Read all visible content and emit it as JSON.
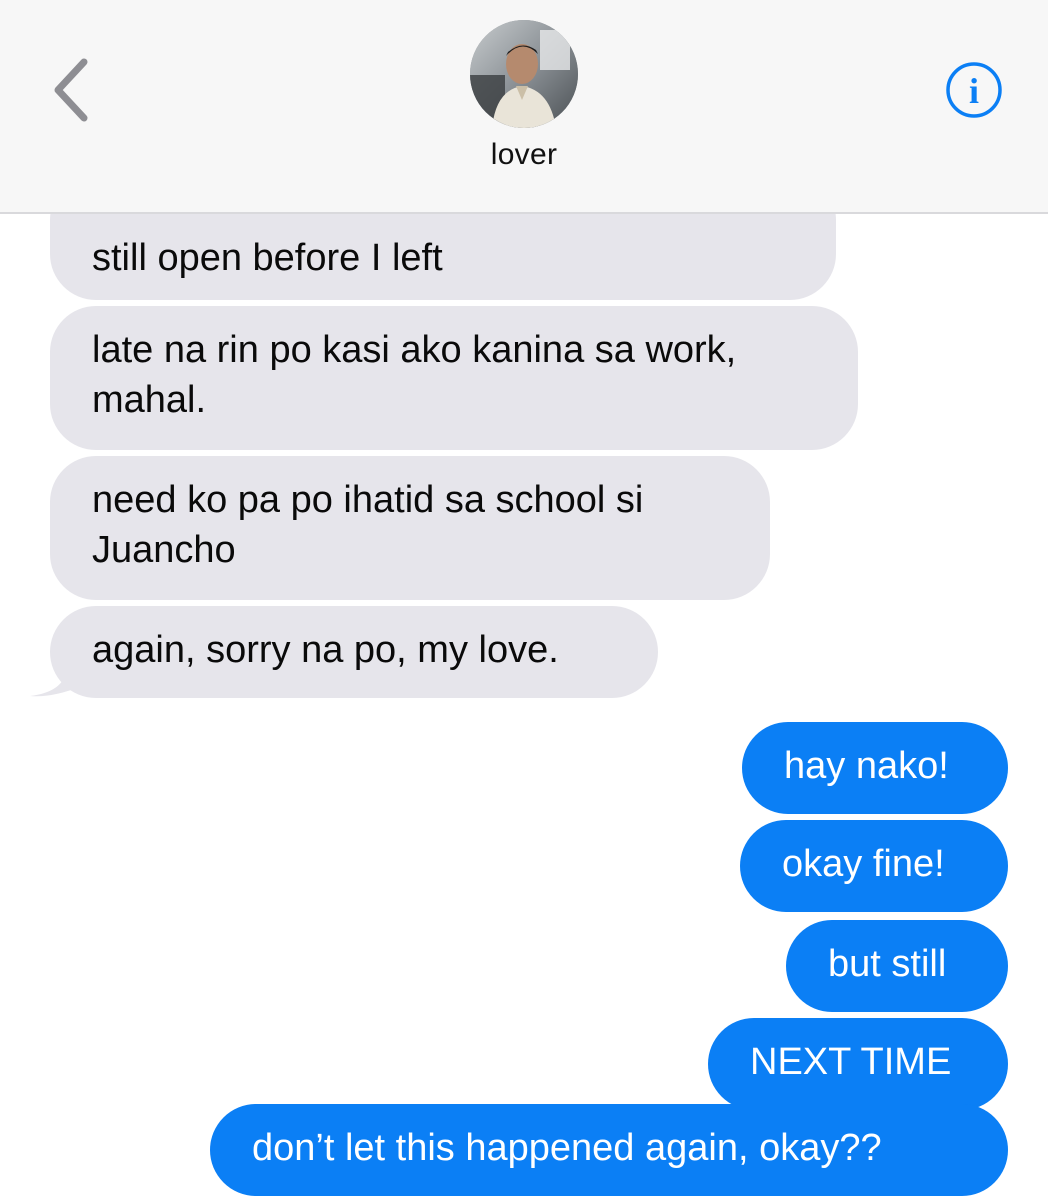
{
  "header": {
    "contact_name": "lover",
    "back_icon": "chevron-left-icon",
    "info_icon": "info-circle-icon",
    "accent_color": "#0b7ff5"
  },
  "messages": [
    {
      "direction": "incoming",
      "text": "still open before I left"
    },
    {
      "direction": "incoming",
      "text_lines": [
        "late na rin po kasi ako kanina sa work,",
        "mahal."
      ]
    },
    {
      "direction": "incoming",
      "text_lines": [
        "need ko pa po ihatid sa school si",
        "Juancho"
      ]
    },
    {
      "direction": "incoming",
      "text": "again, sorry na po, my love."
    },
    {
      "direction": "outgoing",
      "text": "hay nako!"
    },
    {
      "direction": "outgoing",
      "text": "okay fine!"
    },
    {
      "direction": "outgoing",
      "text": "but still"
    },
    {
      "direction": "outgoing",
      "text": "NEXT TIME"
    },
    {
      "direction": "outgoing",
      "text": "don’t let this happened again, okay??"
    }
  ],
  "colors": {
    "incoming_bubble": "#e6e5eb",
    "outgoing_bubble": "#0b7ff5",
    "header_bg": "#f7f7f7"
  }
}
